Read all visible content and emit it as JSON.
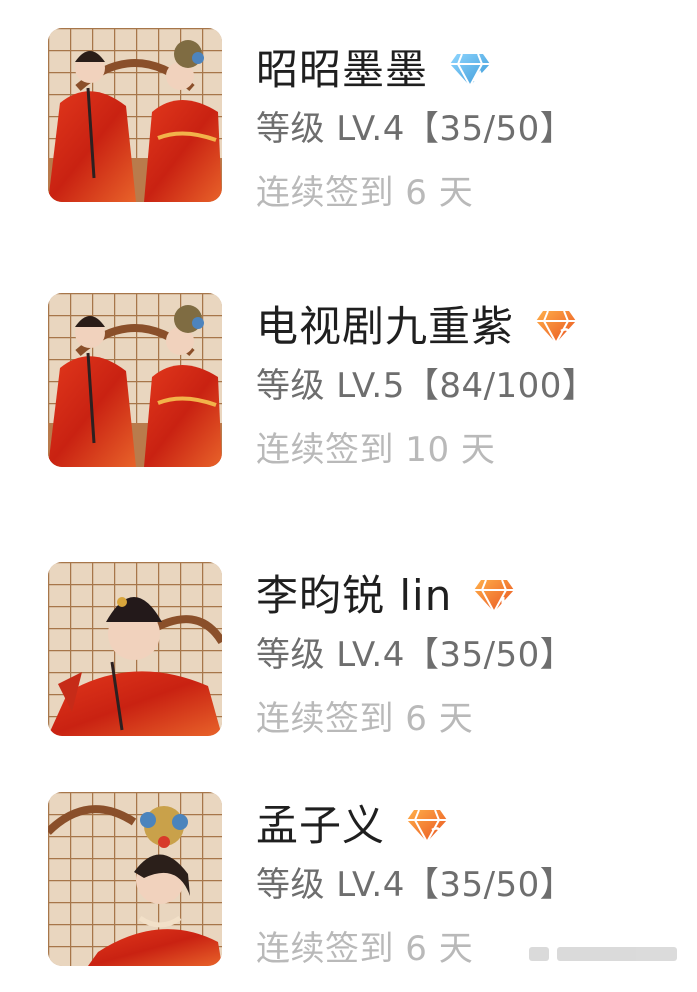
{
  "members": [
    {
      "name": "昭昭墨墨",
      "badge": {
        "icon": "diamond-badge-icon",
        "style": "blue",
        "color": "#5ab4e6"
      },
      "level": "等级 LV.4【35/50】",
      "checkin": "连续签到 6 天",
      "avatar": "couple-wedding-photo"
    },
    {
      "name": "电视剧九重紫",
      "badge": {
        "icon": "diamond-badge-icon",
        "style": "orange",
        "color": "#f08228"
      },
      "level": "等级 LV.5【84/100】",
      "checkin": "连续签到 10 天",
      "avatar": "couple-wedding-photo"
    },
    {
      "name": "李昀锐 lin",
      "badge": {
        "icon": "diamond-badge-icon",
        "style": "orange",
        "color": "#f08228"
      },
      "level": "等级 LV.4【35/50】",
      "checkin": "连续签到 6 天",
      "avatar": "groom-portrait-photo"
    },
    {
      "name": "孟子义",
      "badge": {
        "icon": "diamond-badge-icon",
        "style": "orange",
        "color": "#f08228"
      },
      "level": "等级 LV.4【35/50】",
      "checkin": "连续签到 6 天",
      "avatar": "bride-portrait-photo"
    }
  ]
}
